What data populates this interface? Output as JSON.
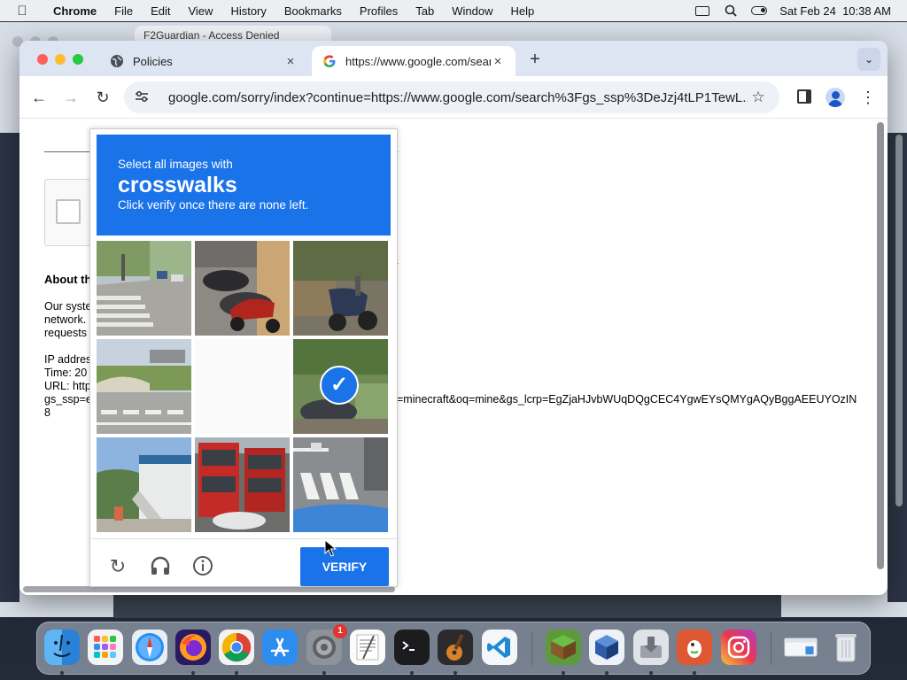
{
  "menubar": {
    "app_name": "Chrome",
    "menus": [
      "File",
      "Edit",
      "View",
      "History",
      "Bookmarks",
      "Profiles",
      "Tab",
      "Window",
      "Help"
    ],
    "datetime": "Sat Feb 24  10:38 AM"
  },
  "background_window": {
    "tab_title": "F2Guardian - Access Denied"
  },
  "tabs": [
    {
      "title": "Policies",
      "favicon": "globe-icon"
    },
    {
      "title": "https://www.google.com/sear",
      "favicon": "google-g-icon"
    }
  ],
  "toolbar": {
    "url": "google.com/sorry/index?continue=https://www.google.com/search%3Fgs_ssp%3DeJzj4tLP1TewL..."
  },
  "page": {
    "about_heading": "About th",
    "lines": [
      "Our syste",
      "network.",
      "requests",
      "",
      "IP addres",
      "Time: 20",
      "URL: http",
      "gs_ssp=e",
      "8"
    ],
    "url_tail": "=minecraft&oq=mine&gs_lcrp=EgZjaHJvbWUqDQgCEC4YgwEYsQMYgAQyBggAEEUYOzIN"
  },
  "captcha": {
    "instruction_line1": "Select all images with",
    "target": "crosswalks",
    "instruction_line3": "Click verify once there are none left.",
    "verify_label": "VERIFY",
    "tiles": [
      {
        "subject": "street with crosswalk",
        "selected": false
      },
      {
        "subject": "parked scooters",
        "selected": false
      },
      {
        "subject": "scooter on street",
        "selected": false
      },
      {
        "subject": "road with crosswalk and bridge",
        "selected": false
      },
      {
        "subject": "blank (loading)",
        "selected": false
      },
      {
        "subject": "scooter near plants",
        "selected": true
      },
      {
        "subject": "building with stairs",
        "selected": false
      },
      {
        "subject": "red double-decker buses",
        "selected": false
      },
      {
        "subject": "crosswalk with car",
        "selected": false
      }
    ]
  },
  "dock": {
    "apps": [
      "Finder",
      "Launchpad",
      "Safari",
      "Firefox",
      "Chrome",
      "App Store",
      "System Settings",
      "TextEdit",
      "Terminal",
      "GarageBand",
      "Visual Studio Code",
      "Minecraft",
      "VirtualBox",
      "Disk Utility",
      "DuckDuckGo",
      "Instagram",
      "Preview",
      "Trash"
    ],
    "settings_badge": "1"
  }
}
